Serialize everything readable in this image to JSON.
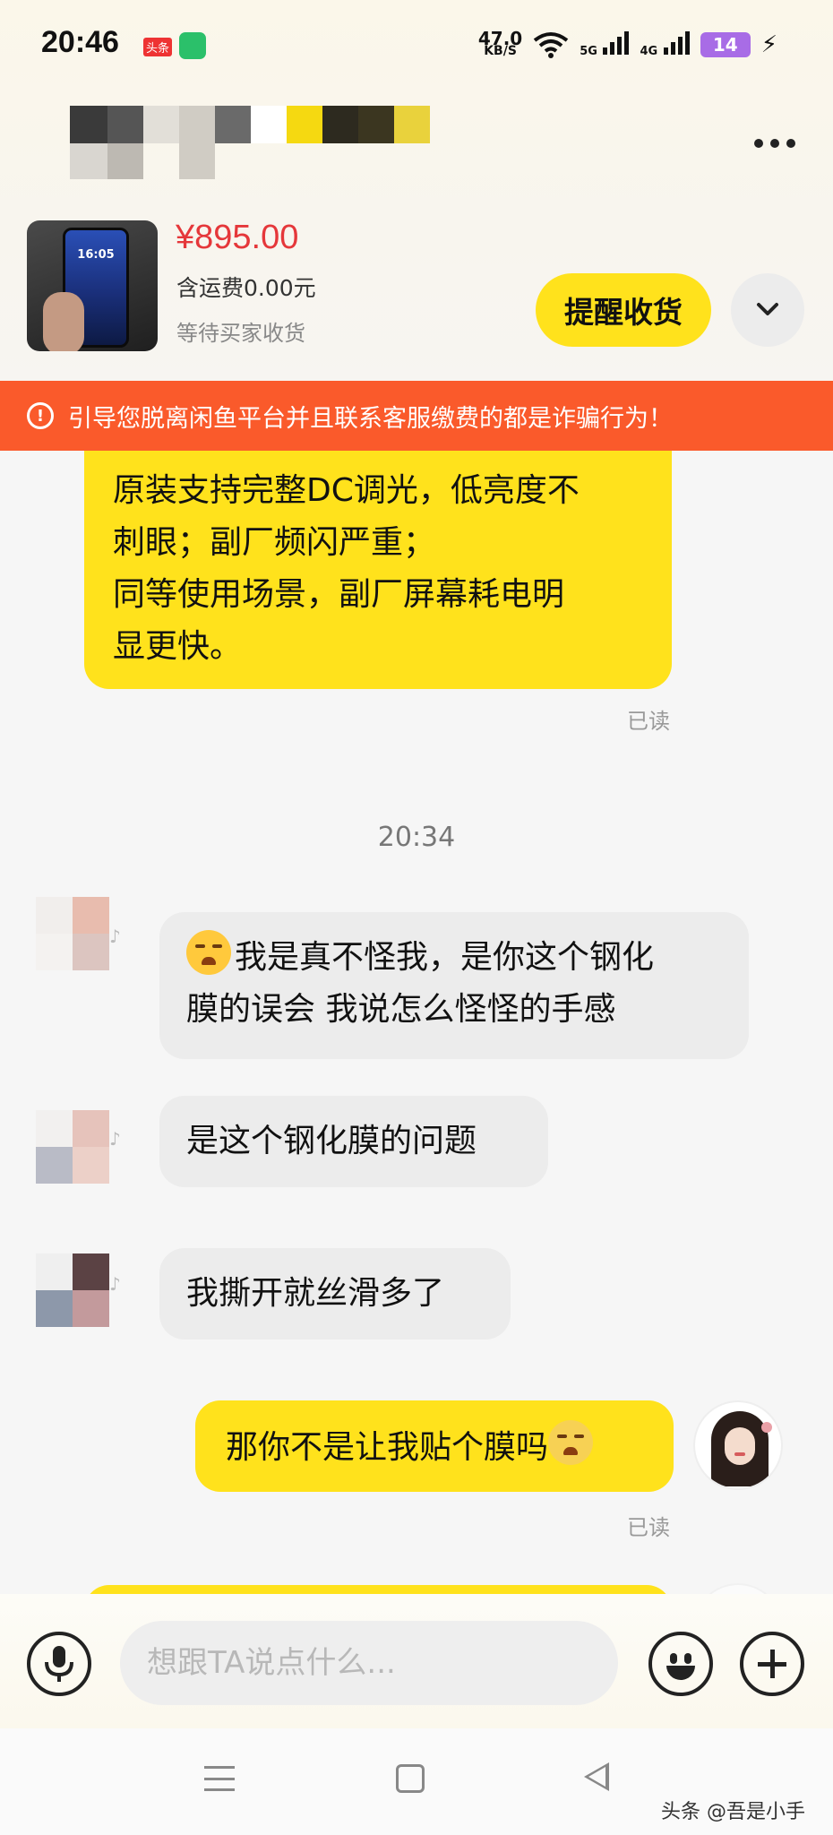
{
  "status_bar": {
    "time": "20:46",
    "toutiao_badge": "头条",
    "net_speed_value": "47.0",
    "net_speed_unit": "KB/S",
    "signal_1": "5G",
    "signal_2": "4G",
    "battery": "14",
    "icons": [
      "wifi-icon",
      "signal-5g-icon",
      "signal-4g-icon",
      "battery-icon",
      "charging-bolt-icon"
    ]
  },
  "header": {
    "peer_name": "",
    "more_icon": "more-horizontal-icon"
  },
  "product": {
    "price": "¥895.00",
    "shipping": "含运费0.00元",
    "status": "等待买家收货",
    "thumb_time": "16:05",
    "remind_label": "提醒收货",
    "expand_icon": "chevron-down-icon"
  },
  "warning": {
    "text": "引导您脱离闲鱼平台并且联系客服缴费的都是诈骗行为！",
    "icon": "alert-circle-icon"
  },
  "messages": [
    {
      "side": "mine",
      "lines": [
        "原装支持完整DC调光，低亮度不",
        "刺眼；副厂频闪严重；",
        "同等使用场景，副厂屏幕耗电明",
        "显更快。"
      ],
      "read": "已读"
    },
    {
      "type": "time",
      "text": "20:34"
    },
    {
      "side": "theirs",
      "emoji": "crying-face-emoji",
      "lines": [
        "我是真不怪我，是你这个钢化",
        "膜的误会  我说怎么怪怪的手感"
      ]
    },
    {
      "side": "theirs",
      "lines": [
        "是这个钢化膜的问题"
      ]
    },
    {
      "side": "theirs",
      "lines": [
        "我撕开就丝滑多了"
      ]
    },
    {
      "side": "mine",
      "emoji": "sad-face-emoji",
      "lines": [
        "那你不是让我贴个膜吗"
      ],
      "read": "已读"
    }
  ],
  "input": {
    "placeholder": "想跟TA说点什么...",
    "mic_icon": "microphone-icon",
    "emoji_icon": "smiley-icon",
    "plus_icon": "plus-icon"
  },
  "nav": {
    "icons": [
      "menu-icon",
      "home-square-icon",
      "back-triangle-icon"
    ]
  },
  "watermark": "头条 @吾是小手",
  "colors": {
    "accent_yellow": "#ffe21c",
    "price_red": "#e5373a",
    "warning_orange": "#fa5a2b",
    "their_bubble": "#ececec"
  }
}
